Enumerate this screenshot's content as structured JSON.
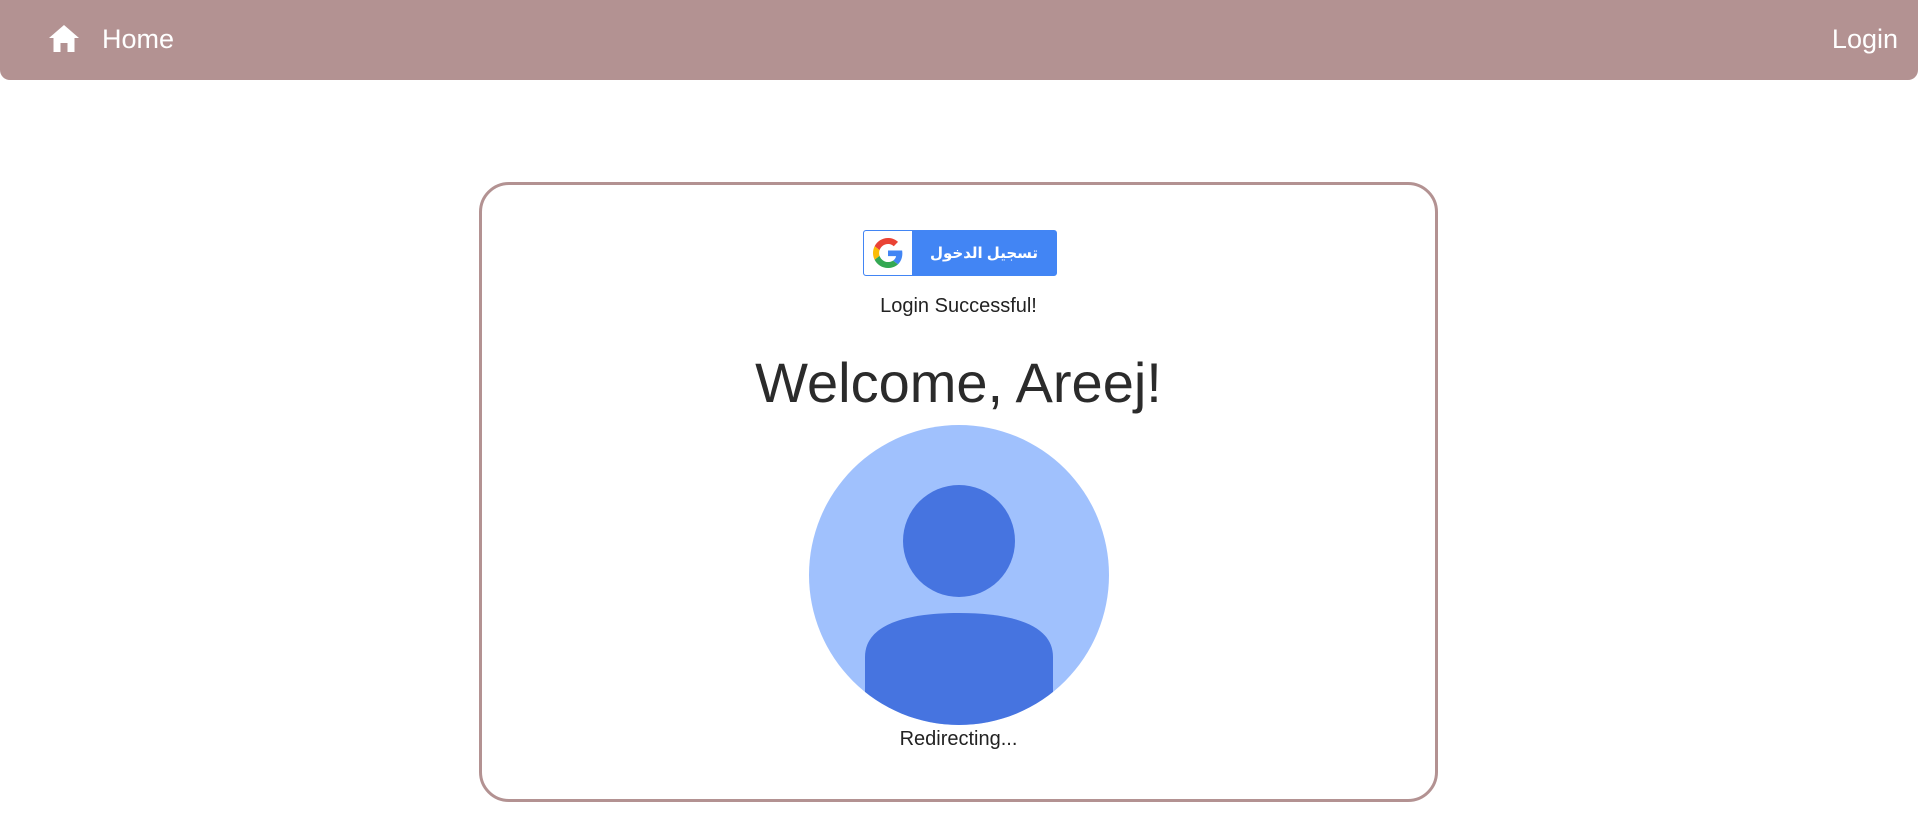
{
  "nav": {
    "home_label": "Home",
    "login_label": "Login",
    "home_icon": "home-icon",
    "bg_color": "#b39292"
  },
  "card": {
    "google_button_label": "تسجيل الدخول",
    "google_icon": "google-g-icon",
    "status_text": "Login Successful!",
    "welcome_text": "Welcome, Areej!",
    "avatar_icon": "user-avatar-icon",
    "redirect_text": "Redirecting...",
    "accent_color": "#4285f4",
    "border_color": "#b39292"
  }
}
